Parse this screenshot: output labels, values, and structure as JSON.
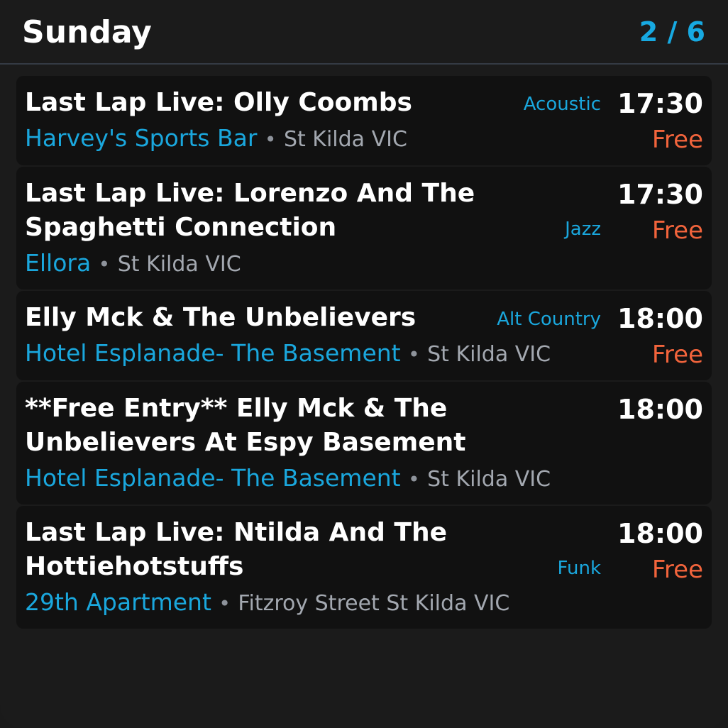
{
  "header": {
    "day": "Sunday",
    "page": "2 / 6"
  },
  "events": [
    {
      "title": "Last Lap Live: Olly Coombs",
      "venue": "Harvey's Sports Bar",
      "separator": "•",
      "location": "St Kilda VIC",
      "genre": "Acoustic",
      "time": "17:30",
      "price": "Free"
    },
    {
      "title": "Last Lap Live: Lorenzo And The Spaghetti Connection",
      "venue": "Ellora",
      "separator": "•",
      "location": "St Kilda VIC",
      "genre": "Jazz",
      "time": "17:30",
      "price": "Free"
    },
    {
      "title": "Elly Mck & The Unbelievers",
      "venue": "Hotel Esplanade- The Basement",
      "separator": "•",
      "location": "St Kilda VIC",
      "genre": "Alt Country",
      "time": "18:00",
      "price": "Free"
    },
    {
      "title": "**Free Entry** Elly Mck & The Unbelievers At Espy Basement",
      "venue": "Hotel Esplanade- The Basement",
      "separator": "•",
      "location": "St Kilda VIC",
      "genre": "",
      "time": "18:00",
      "price": ""
    },
    {
      "title": "Last Lap Live: Ntilda And The Hottiehotstuffs",
      "venue": "29th Apartment",
      "separator": "•",
      "location": "Fitzroy Street St Kilda VIC",
      "genre": "Funk",
      "time": "18:00",
      "price": "Free"
    }
  ],
  "colors": {
    "accent": "#17a9e1",
    "price": "#f2643c",
    "card_bg": "#111111",
    "page_bg": "#1b1b1b"
  }
}
